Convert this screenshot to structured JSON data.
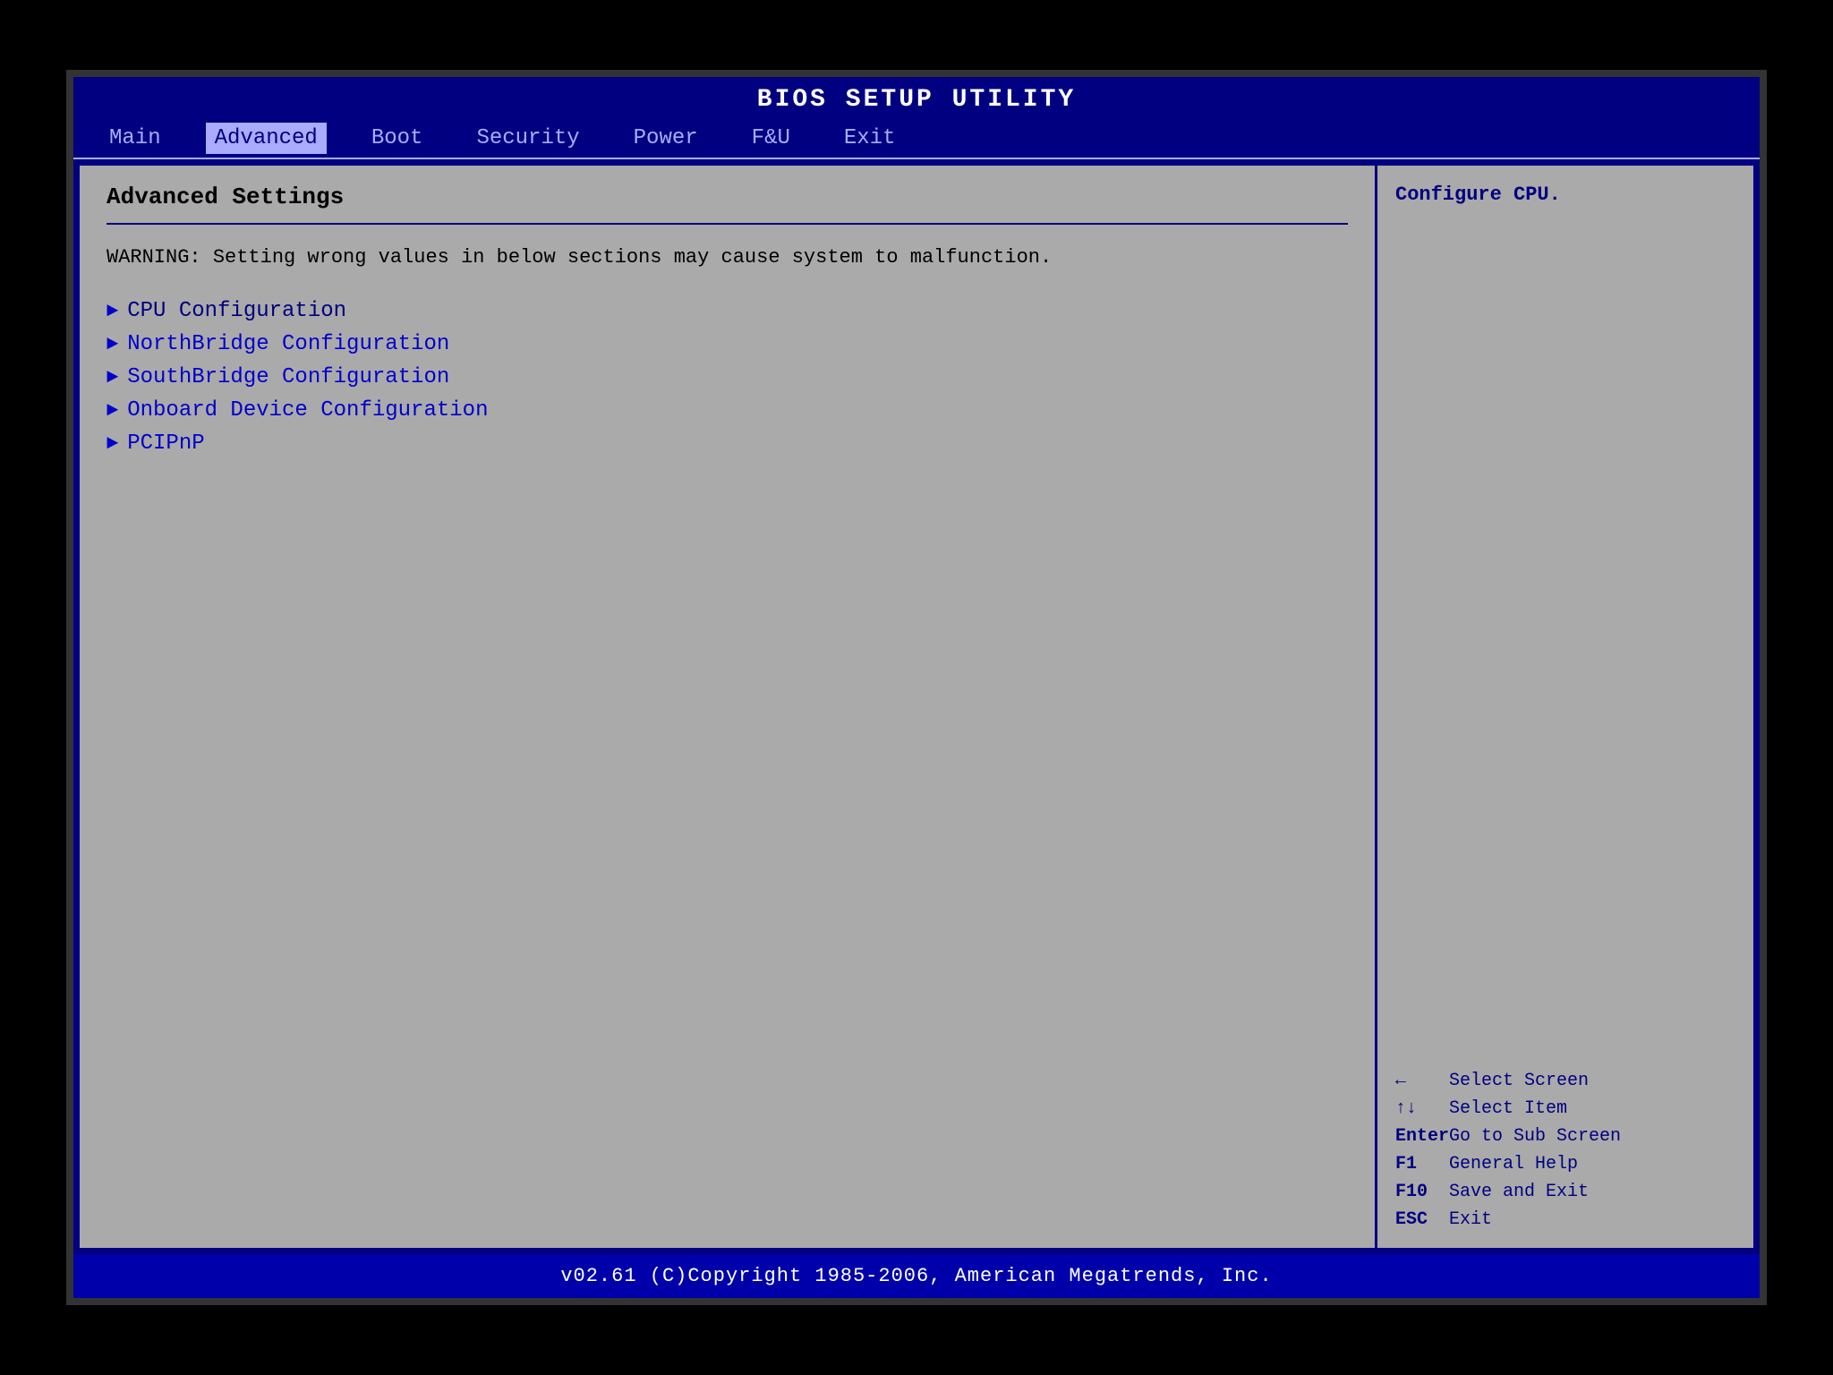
{
  "title": "BIOS SETUP UTILITY",
  "nav": {
    "tabs": [
      {
        "label": "Main",
        "active": false
      },
      {
        "label": "Advanced",
        "active": true
      },
      {
        "label": "Boot",
        "active": false
      },
      {
        "label": "Security",
        "active": false
      },
      {
        "label": "Power",
        "active": false
      },
      {
        "label": "F&U",
        "active": false
      },
      {
        "label": "Exit",
        "active": false
      }
    ]
  },
  "left_panel": {
    "section_title": "Advanced Settings",
    "warning": "WARNING: Setting wrong values in below sections\n        may cause system to malfunction.",
    "menu_items": [
      {
        "label": "CPU Configuration",
        "selected": true
      },
      {
        "label": "NorthBridge Configuration",
        "selected": false
      },
      {
        "label": "SouthBridge Configuration",
        "selected": false
      },
      {
        "label": "Onboard Device Configuration",
        "selected": false
      },
      {
        "label": "PCIPnP",
        "selected": false
      }
    ]
  },
  "right_panel": {
    "help_text": "Configure CPU.",
    "key_hints": [
      {
        "key": "←",
        "desc": "Select Screen"
      },
      {
        "key": "↑↓",
        "desc": "Select Item"
      },
      {
        "key": "Enter",
        "desc": "Go to Sub Screen"
      },
      {
        "key": "F1",
        "desc": "General Help"
      },
      {
        "key": "F10",
        "desc": "Save and Exit"
      },
      {
        "key": "ESC",
        "desc": "Exit"
      }
    ]
  },
  "footer": "v02.61 (C)Copyright 1985-2006, American Megatrends, Inc."
}
